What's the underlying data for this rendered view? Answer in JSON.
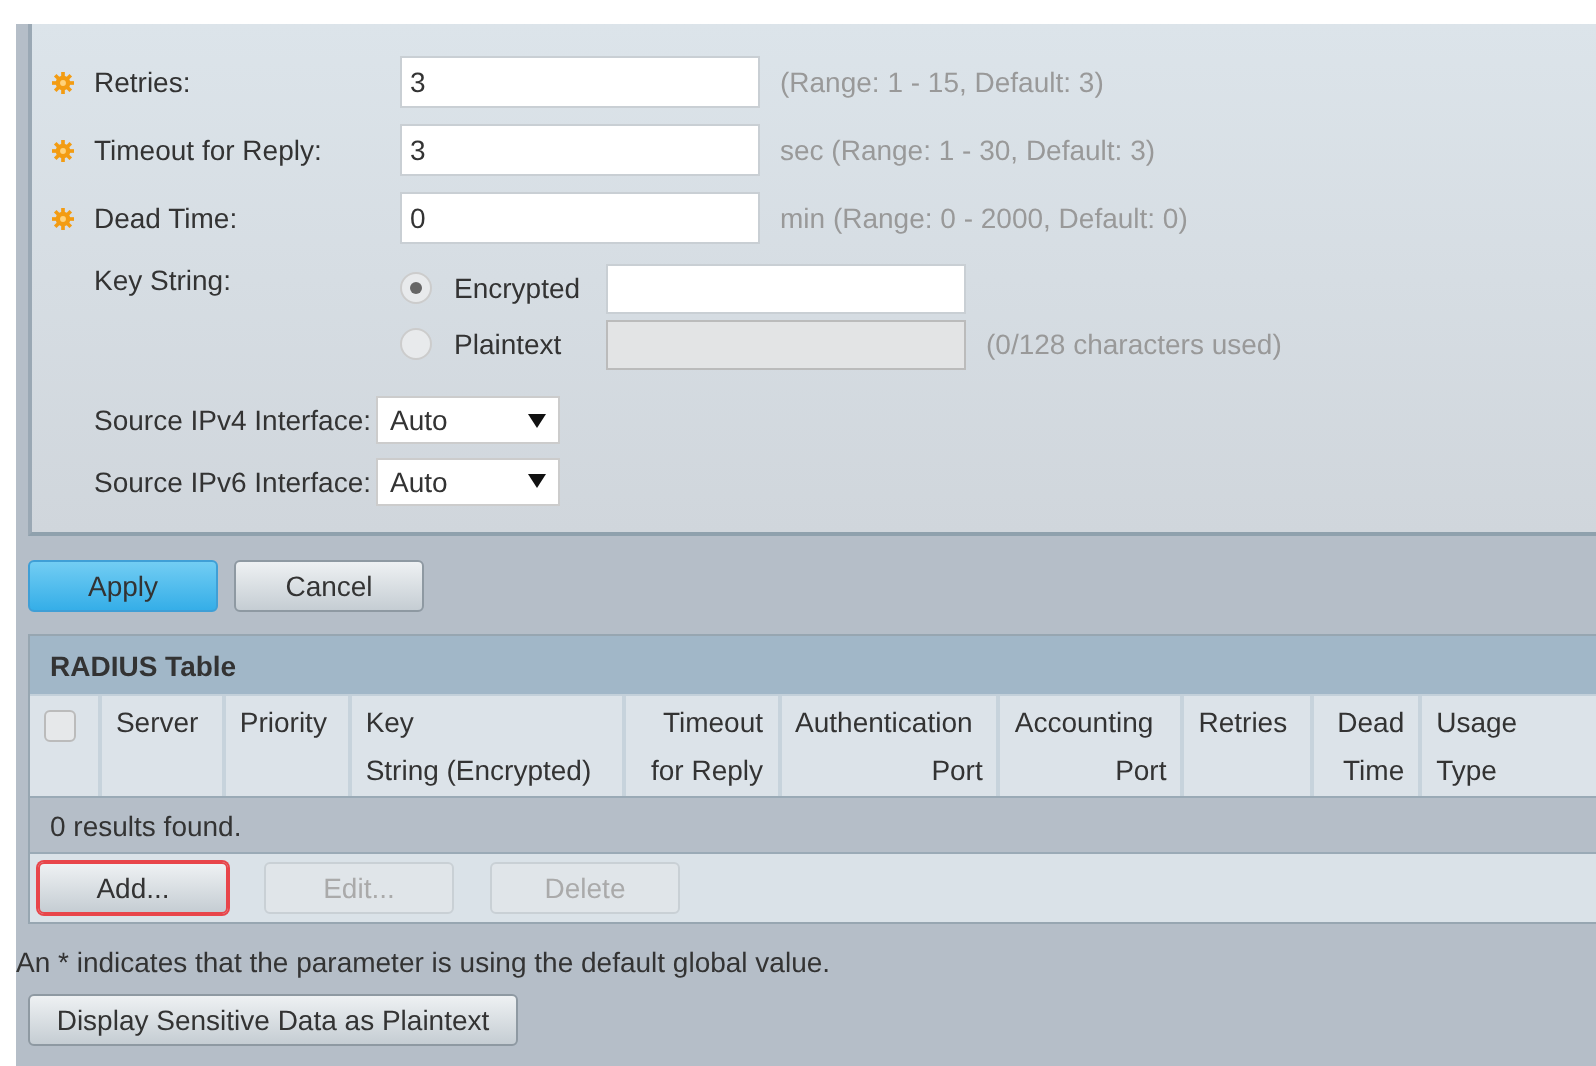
{
  "settings": [
    {
      "kind": "number",
      "label": "Retries:",
      "value": "3",
      "hint": "(Range: 1 - 15, Default: 3)",
      "uses_default": true
    },
    {
      "kind": "number",
      "label": "Timeout for Reply:",
      "value": "3",
      "hint": "sec (Range: 1 - 30, Default: 3)",
      "uses_default": true
    },
    {
      "kind": "number",
      "label": "Dead Time:",
      "value": "0",
      "hint": "min (Range: 0 - 2000, Default: 0)",
      "uses_default": true
    }
  ],
  "key_string": {
    "label": "Key String:",
    "options": [
      {
        "label": "Encrypted",
        "selected": true
      },
      {
        "label": "Plaintext",
        "selected": false,
        "hint": "(0/128 characters used)"
      }
    ]
  },
  "selects": [
    {
      "label": "Source IPv4 Interface:",
      "value": "Auto"
    },
    {
      "label": "Source IPv6 Interface:",
      "value": "Auto"
    }
  ],
  "form_buttons": [
    {
      "label": "Apply",
      "primary": true
    },
    {
      "label": "Cancel",
      "primary": false
    }
  ],
  "table": {
    "title": "RADIUS Table",
    "select_all_checked": false,
    "columns": [
      {
        "lines": [
          "Server"
        ]
      },
      {
        "lines": [
          "Priority"
        ]
      },
      {
        "lines": [
          "Key",
          "String (Encrypted)"
        ]
      },
      {
        "lines": [
          "Timeout",
          "for Reply"
        ]
      },
      {
        "lines": [
          "Authentication",
          "Port"
        ]
      },
      {
        "lines": [
          "Accounting",
          "Port"
        ]
      },
      {
        "lines": [
          "Retries"
        ]
      },
      {
        "lines": [
          "Dead",
          "Time"
        ]
      },
      {
        "lines": [
          "Usage",
          "Type"
        ]
      }
    ],
    "status": "0 results found.",
    "buttons": [
      {
        "label": "Add...",
        "disabled": false,
        "highlighted": true
      },
      {
        "label": "Edit...",
        "disabled": true,
        "highlighted": false
      },
      {
        "label": "Delete",
        "disabled": true,
        "highlighted": false
      }
    ]
  },
  "note": "An * indicates that the parameter is using the default global value.",
  "bottom_button": "Display Sensitive Data as Plaintext"
}
